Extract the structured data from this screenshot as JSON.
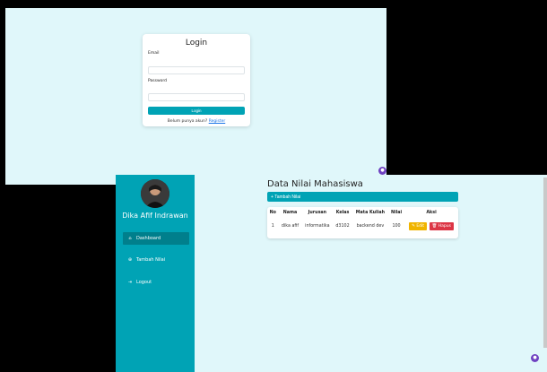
{
  "login": {
    "title": "Login",
    "email_label": "Email",
    "email_value": "",
    "password_label": "Password",
    "password_value": "",
    "button_label": "Login",
    "register_text": "Belum punya akun?",
    "register_link": "Register"
  },
  "sidebar": {
    "user_name": "Dika Afif Indrawan",
    "items": [
      {
        "label": "Dashboard",
        "icon": "home-icon",
        "active": true
      },
      {
        "label": "Tambah Nilai",
        "icon": "plus-circle-icon",
        "active": false
      },
      {
        "label": "Logout",
        "icon": "logout-icon",
        "active": false
      }
    ]
  },
  "main": {
    "title": "Data Nilai Mahasiswa",
    "add_button": "+ Tambah Nilai",
    "table": {
      "headers": [
        "No",
        "Nama",
        "Jurusan",
        "Kelas",
        "Mata Kuliah",
        "Nilai",
        "Aksi"
      ],
      "rows": [
        {
          "no": "1",
          "nama": "dika afif",
          "jurusan": "informatika",
          "kelas": "d3102",
          "mata_kuliah": "backend dev",
          "nilai": "100"
        }
      ],
      "edit_label": "Edit",
      "delete_label": "Hapus"
    }
  },
  "colors": {
    "accent": "#00a3b5",
    "background": "#e0f7fa",
    "warning": "#f0b400",
    "danger": "#dc3545"
  }
}
